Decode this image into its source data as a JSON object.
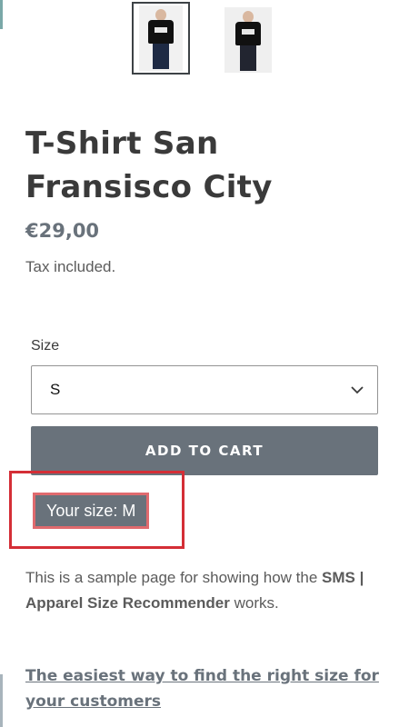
{
  "gallery": {
    "thumbnails": [
      {
        "icon": "product-photo-front",
        "selected": true
      },
      {
        "icon": "product-photo-alt",
        "selected": false
      }
    ]
  },
  "product": {
    "title": "T-Shirt San Fransisco City",
    "price": "€29,00",
    "tax_note": "Tax included."
  },
  "variant": {
    "label": "Size",
    "selected": "S",
    "chevron_icon": "chevron-down-icon"
  },
  "actions": {
    "add_to_cart": "ADD TO CART",
    "your_size": "Your size: M"
  },
  "description": {
    "before": "This is a sample page for showing how the ",
    "bold": "SMS | Apparel Size Recommender",
    "after": " works."
  },
  "promo_link": "The easiest way to find the right size for your customers",
  "colors": {
    "button": "#69727b",
    "highlight": "#d42e36",
    "text": "#3a3a3a"
  }
}
